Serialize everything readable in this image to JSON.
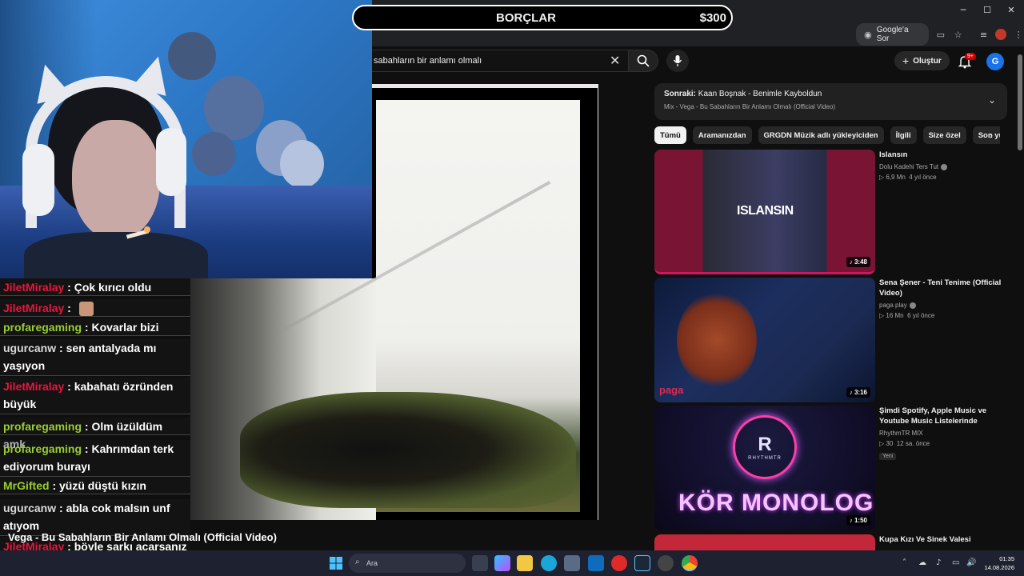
{
  "overlay": {
    "debt_label": "BORÇLAR",
    "debt_amount": "$300",
    "video_title": "Vega - Bu Sabahların Bir Anlamı Olmalı (Official Video)"
  },
  "browser": {
    "google_sor": "Google'a Sor"
  },
  "youtube": {
    "search_value": "sabahların bir anlamı olmalı",
    "create_label": "Oluştur",
    "notif_badge": "9+",
    "avatar_letter": "G"
  },
  "up_next": {
    "label": "Sonraki:",
    "title": "Kaan Boşnak - Benimle Kayboldun",
    "subtitle": "Mix - Vega - Bu Sabahların Bir Anlamı Olmalı (Official Video)"
  },
  "chips": [
    "Tümü",
    "Aramanızdan",
    "GRGDN Müzik adlı yükleyiciden",
    "İlgili",
    "Size özel",
    "Son yü"
  ],
  "recommendations": [
    {
      "title": "Islansın",
      "thumb_text": "ISLANSIN",
      "channel": "Dolu Kadehi Ters Tut",
      "verified": true,
      "views": "6,9 Mn",
      "age": "4 yıl önce",
      "duration": "3:48"
    },
    {
      "title": "Sena Şener - Teni Tenime (Official Video)",
      "thumb_text": "paga",
      "channel": "paga play",
      "verified": true,
      "views": "16 Mn",
      "age": "6 yıl önce",
      "duration": "3:16"
    },
    {
      "title": "Şimdi Spotify, Apple Music ve Youtube Music Listelerinde",
      "thumb_text": "KÖR MONOLOG",
      "thumb_brand": "RHYTHMTR",
      "channel": "RhythmTR MIX",
      "verified": false,
      "views": "30",
      "age": "12 sa. önce",
      "badge": "Yeni",
      "duration": "1:50"
    },
    {
      "title": "Kupa Kızı Ve Sinek Valesi"
    }
  ],
  "chat": [
    {
      "user": "JiletMiralay",
      "color": "#e5173f",
      "text": "Çok kırıcı oldu"
    },
    {
      "user": "JiletMiralay",
      "color": "#e5173f",
      "text": "",
      "emote": true
    },
    {
      "user": "profaregaming",
      "color": "#9acd32",
      "text": "Kovarlar bizi"
    },
    {
      "user": "ugurcanw",
      "color": "#d9d9d9",
      "text": "sen antalyada mı yaşıyon"
    },
    {
      "user": "JiletMiralay",
      "color": "#e5173f",
      "text": "kabahatı özründen büyük"
    },
    {
      "user": "profaregaming",
      "color": "#9acd32",
      "text": "Olm üzüldüm amk"
    },
    {
      "user": "profaregaming",
      "color": "#9acd32",
      "text": "Kahrımdan terk ediyorum burayı"
    },
    {
      "user": "MrGifted",
      "color": "#9acd32",
      "text": "yüzü düştü kızın"
    },
    {
      "user": "ugurcanw",
      "color": "#d9d9d9",
      "text": "abla cok malsın unf atıyom"
    },
    {
      "user": "JiletMiralay",
      "color": "#e5173f",
      "text": "böyle şarkı açarsanız ağlar bile aq"
    }
  ],
  "taskbar": {
    "search_placeholder": "Ara",
    "time": "01:35",
    "date": "14.08.2026"
  },
  "colors": {
    "yt_bg": "#0f0f0f",
    "accent_red": "#cc0000",
    "chip_active": "#f1f1f1"
  }
}
